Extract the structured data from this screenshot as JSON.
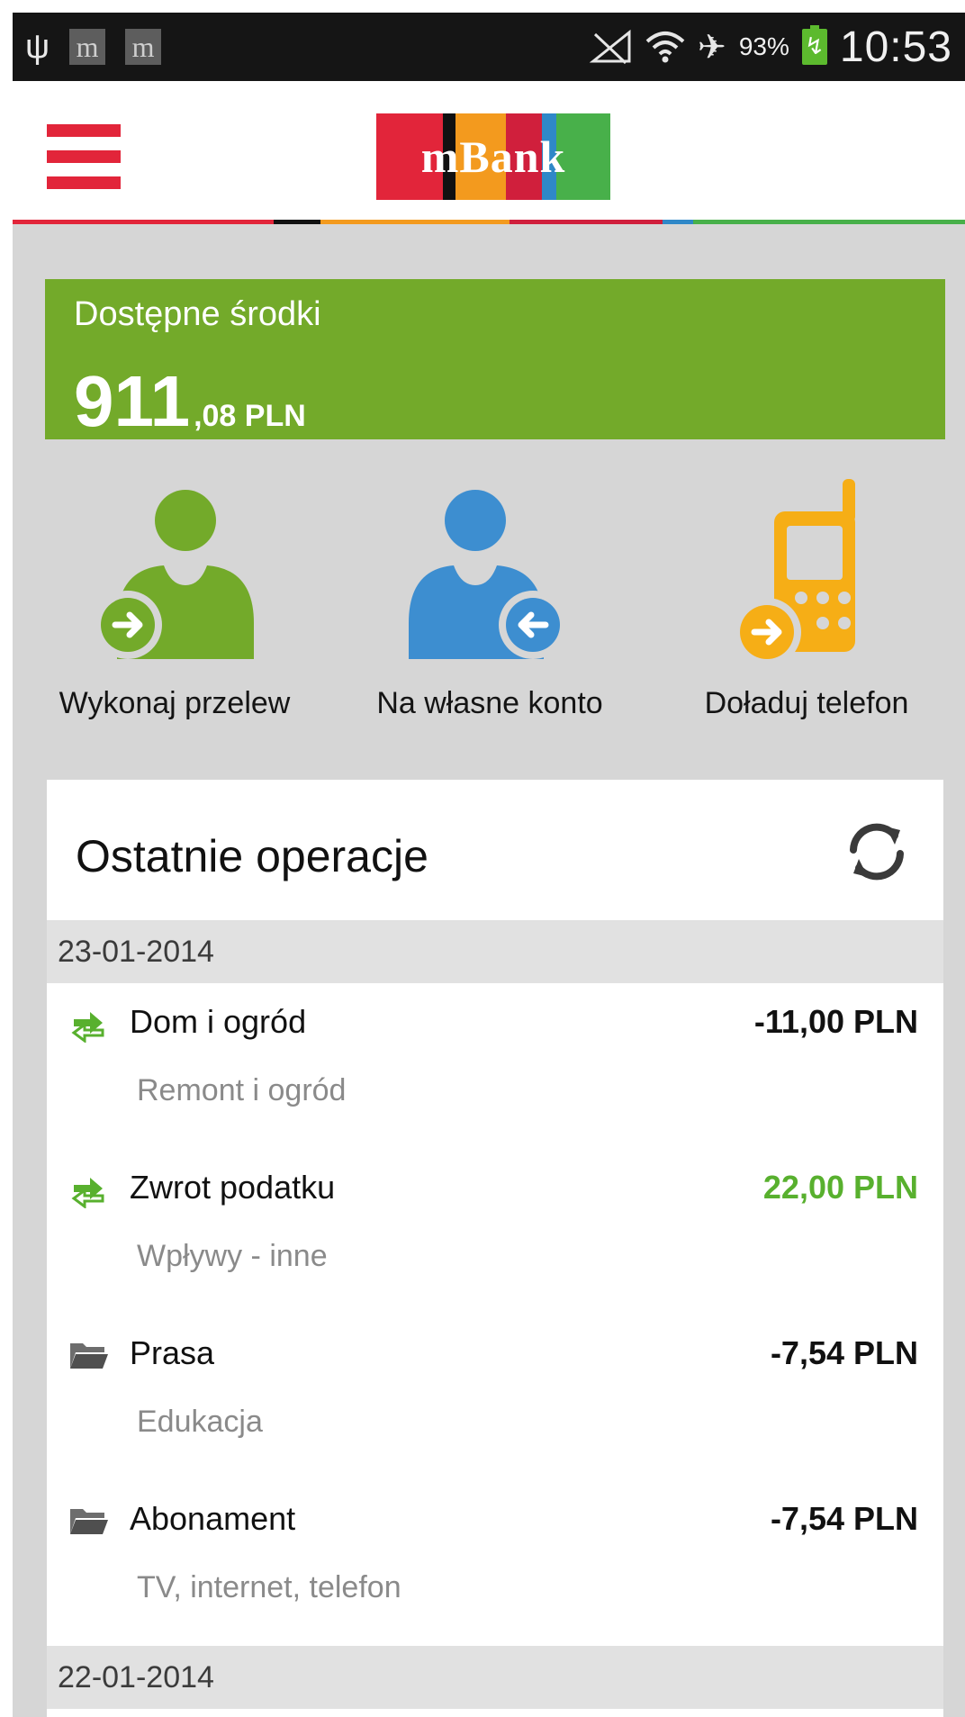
{
  "status_bar": {
    "time": "10:53",
    "battery_percent": "93%",
    "icons": [
      "usb-icon",
      "mbank-notification-icon",
      "mbank-notification-icon",
      "no-signal-icon",
      "wifi-icon",
      "airplane-mode-icon",
      "battery-charging-icon"
    ]
  },
  "header": {
    "logo_text": "mBank",
    "logo_colors": [
      "#e2253a",
      "#111111",
      "#f39a1e",
      "#d01f3c",
      "#2f88c8",
      "#48b04a"
    ],
    "menu_icon": "hamburger-menu-icon"
  },
  "balance": {
    "label": "Dostępne środki",
    "amount_int": "911",
    "amount_dec": ",08 PLN"
  },
  "actions": [
    {
      "label": "Wykonaj przelew",
      "icon": "person-transfer-icon",
      "color": "#73aa2a"
    },
    {
      "label": "Na własne konto",
      "icon": "person-own-account-icon",
      "color": "#3d8ed0"
    },
    {
      "label": "Doładuj telefon",
      "icon": "phone-topup-icon",
      "color": "#f6ae16"
    }
  ],
  "recent": {
    "title": "Ostatnie operacje",
    "refresh_icon": "refresh-icon",
    "groups": [
      {
        "date": "23-01-2014",
        "operations": [
          {
            "name": "Dom i ogród",
            "category": "Remont i ogród",
            "amount": "-11,00 PLN",
            "icon": "transfer-arrows-icon",
            "positive": false
          },
          {
            "name": "Zwrot podatku",
            "category": "Wpływy - inne",
            "amount": "22,00 PLN",
            "icon": "transfer-arrows-icon",
            "positive": true
          },
          {
            "name": "Prasa",
            "category": "Edukacja",
            "amount": "-7,54 PLN",
            "icon": "folder-icon",
            "positive": false
          },
          {
            "name": "Abonament",
            "category": "TV, internet, telefon",
            "amount": "-7,54 PLN",
            "icon": "folder-icon",
            "positive": false
          }
        ]
      },
      {
        "date": "22-01-2014",
        "operations": []
      }
    ]
  }
}
